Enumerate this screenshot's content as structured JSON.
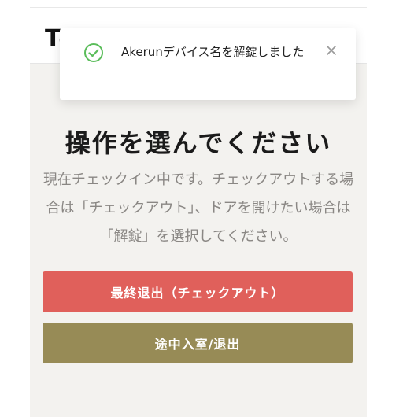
{
  "header": {
    "brand": "To     Sh"
  },
  "main": {
    "title": "操作を選んでください",
    "description": "現在チェックイン中です。チェックアウトする場合は「チェックアウト」、ドアを開けたい場合は「解錠」を選択してください。",
    "buttons": {
      "checkout_label": "最終退出（チェックアウト）",
      "enter_exit_label": "途中入室/退出"
    }
  },
  "toast": {
    "message": "Akerunデバイス名を解錠しました",
    "icon": "check-circle-icon",
    "close_icon": "close-icon"
  },
  "colors": {
    "primary_button": "#e0605b",
    "secondary_button": "#978b56",
    "success_icon": "#5bbd5b",
    "background": "#f3f2ef"
  }
}
